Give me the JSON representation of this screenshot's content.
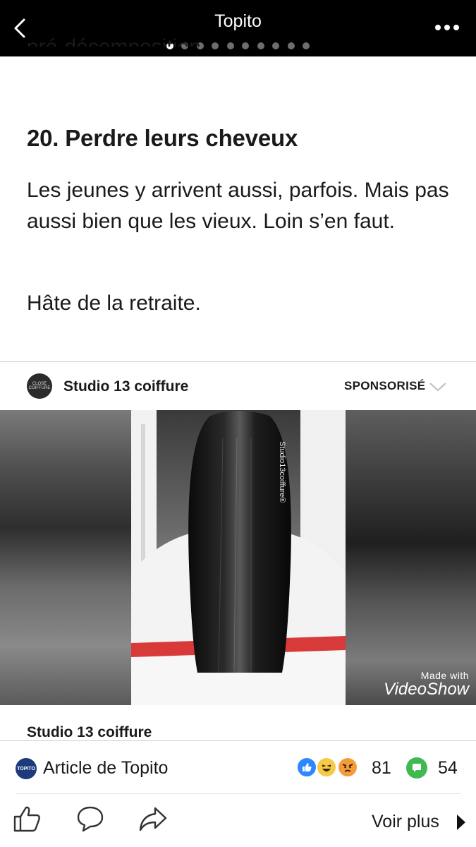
{
  "top_bar": {
    "title": "Topito",
    "page_dots": 10,
    "active_dot": 0
  },
  "article": {
    "clipped_text": "pré-décomposition.",
    "heading": "20. Perdre leurs cheveux",
    "paragraph1": "Les jeunes y arrivent aussi, parfois. Mais pas aussi bien que les vieux. Loin s’en faut.",
    "paragraph2": "Hâte de la retraite."
  },
  "sponsored": {
    "advertiser": "Studio 13 coiffure",
    "label": "SPONSORISÉ",
    "avatar_text": "CLOSE COIFFURE",
    "hair_tag": "Studio13coiffure®",
    "watermark_line1": "Made with",
    "watermark_line2": "VideoShow",
    "caption": "Studio 13 coiffure"
  },
  "attribution": {
    "logo_text": "TOPITO",
    "text": "Article de Topito",
    "reaction_icons": [
      "like-icon",
      "haha-icon",
      "angry-icon"
    ],
    "reaction_count": "81",
    "comment_count": "54"
  },
  "actions": {
    "see_more": "Voir plus"
  },
  "colors": {
    "topbar_bg": "#000000",
    "like_blue": "#2d88ff",
    "comment_green": "#3fb950",
    "link_navy": "#1d3b7a"
  }
}
